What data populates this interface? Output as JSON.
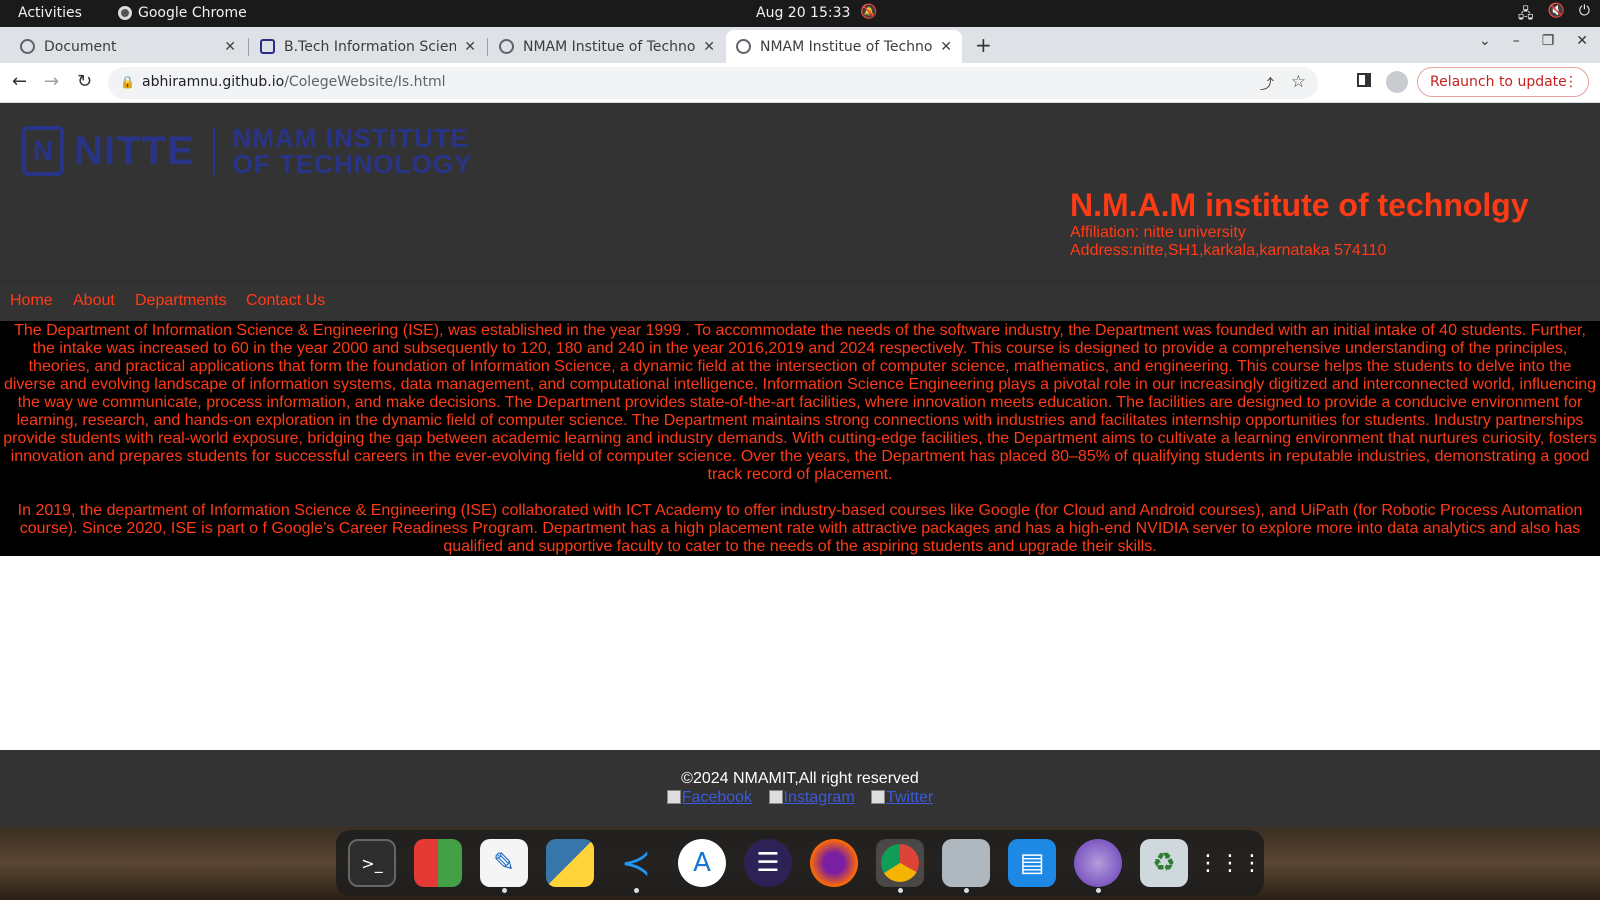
{
  "system": {
    "activities": "Activities",
    "app_name": "Google Chrome",
    "clock": "Aug 20  15:33"
  },
  "browser": {
    "tabs": [
      {
        "title": "Document",
        "active": false
      },
      {
        "title": "B.Tech Information Scien",
        "active": false
      },
      {
        "title": "NMAM Institue of Techno",
        "active": false
      },
      {
        "title": "NMAM Institue of Techno",
        "active": true
      }
    ],
    "url_host": "abhiramnu.github.io",
    "url_path": "/ColegeWebsite/Is.html",
    "relaunch_label": "Relaunch to update"
  },
  "site": {
    "logo": {
      "brand": "NITTE",
      "institute_line1": "NMAM INSTITUTE",
      "institute_line2": "OF TECHNOLOGY"
    },
    "title": "N.M.A.M institute of technolgy",
    "affiliation": "Affiliation: nitte university",
    "address": "Address:nitte,SH1,karkala,karnataka 574110",
    "nav": [
      "Home",
      "About",
      "Departments",
      "Contact Us"
    ],
    "paragraph1": "The Department of Information Science & Engineering (ISE), was established in the year 1999 . To accommodate the needs of the software industry, the Department was founded with an initial intake of 40 students. Further, the intake was increased to 60 in the year 2000 and subsequently to 120, 180 and 240 in the year 2016,2019 and 2024 respectively. This course is designed to provide a comprehensive understanding of the principles, theories, and practical applications that form the foundation of Information Science, a dynamic field at the intersection of computer science, mathematics, and engineering. This course helps the students to delve into the diverse and evolving landscape of information systems, data management, and computational intelligence. Information Science Engineering plays a pivotal role in our increasingly digitized and interconnected world, influencing the way we communicate, process information, and make decisions. The Department provides state-of-the-art facilities, where innovation meets education. The facilities are designed to provide a conducive environment for learning, research, and hands-on exploration in the dynamic field of computer science. The Department maintains strong connections with industries and facilitates internship opportunities for students. Industry partnerships provide students with real-world exposure, bridging the gap between academic learning and industry demands. With cutting-edge facilities, the Department aims to cultivate a learning environment that nurtures curiosity, fosters innovation and prepares students for successful careers in the ever-evolving field of computer science. Over the years, the Department has placed 80–85% of qualifying students in reputable industries, demonstrating a good track record of placement.",
    "paragraph2": "In 2019, the department of Information Science & Engineering (ISE) collaborated with ICT Academy to offer industry-based courses like Google (for Cloud and Android courses), and UiPath (for Robotic Process Automation course). Since 2020, ISE is part o f Google’s Career Readiness Program. Department has a high placement rate with attractive packages and has a high-end NVIDIA server to explore more into data analytics and also has qualified and supportive faculty to cater to the needs of the aspiring students and upgrade their skills.",
    "footer_copy": "©2024 NMAMIT,All right reserved",
    "social": [
      "Facebook",
      "Instagram",
      "Twitter"
    ]
  },
  "dock": [
    "terminal-icon",
    "app-grid-color-icon",
    "text-editor-icon",
    "python-icon",
    "vscode-icon",
    "app-store-icon",
    "eclipse-icon",
    "firefox-icon",
    "chrome-icon",
    "files-icon",
    "document-viewer-icon",
    "network-icon",
    "trash-icon",
    "show-apps-icon"
  ]
}
